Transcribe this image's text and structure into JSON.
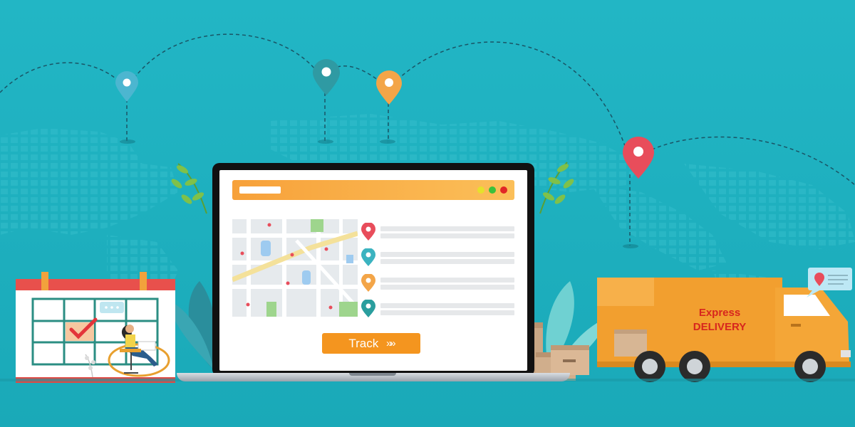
{
  "browser": {
    "window_controls": [
      "yellow",
      "green",
      "red"
    ]
  },
  "tracking_list": {
    "pins": [
      {
        "icon": "map-pin-icon",
        "color": "#e84d5b"
      },
      {
        "icon": "map-pin-icon",
        "color": "#3bb3c0"
      },
      {
        "icon": "map-pin-icon",
        "color": "#f3a548"
      },
      {
        "icon": "map-pin-icon",
        "color": "#2a9e9e"
      }
    ]
  },
  "track_button": {
    "label": "Track",
    "icon": "double-chevron-right-icon"
  },
  "truck": {
    "line1": "Express",
    "line2": "DELIVERY"
  },
  "colors": {
    "background": "#1fb0bf",
    "accent_orange": "#f4951f",
    "truck_body": "#f29f2f",
    "truck_text": "#d7261e"
  }
}
